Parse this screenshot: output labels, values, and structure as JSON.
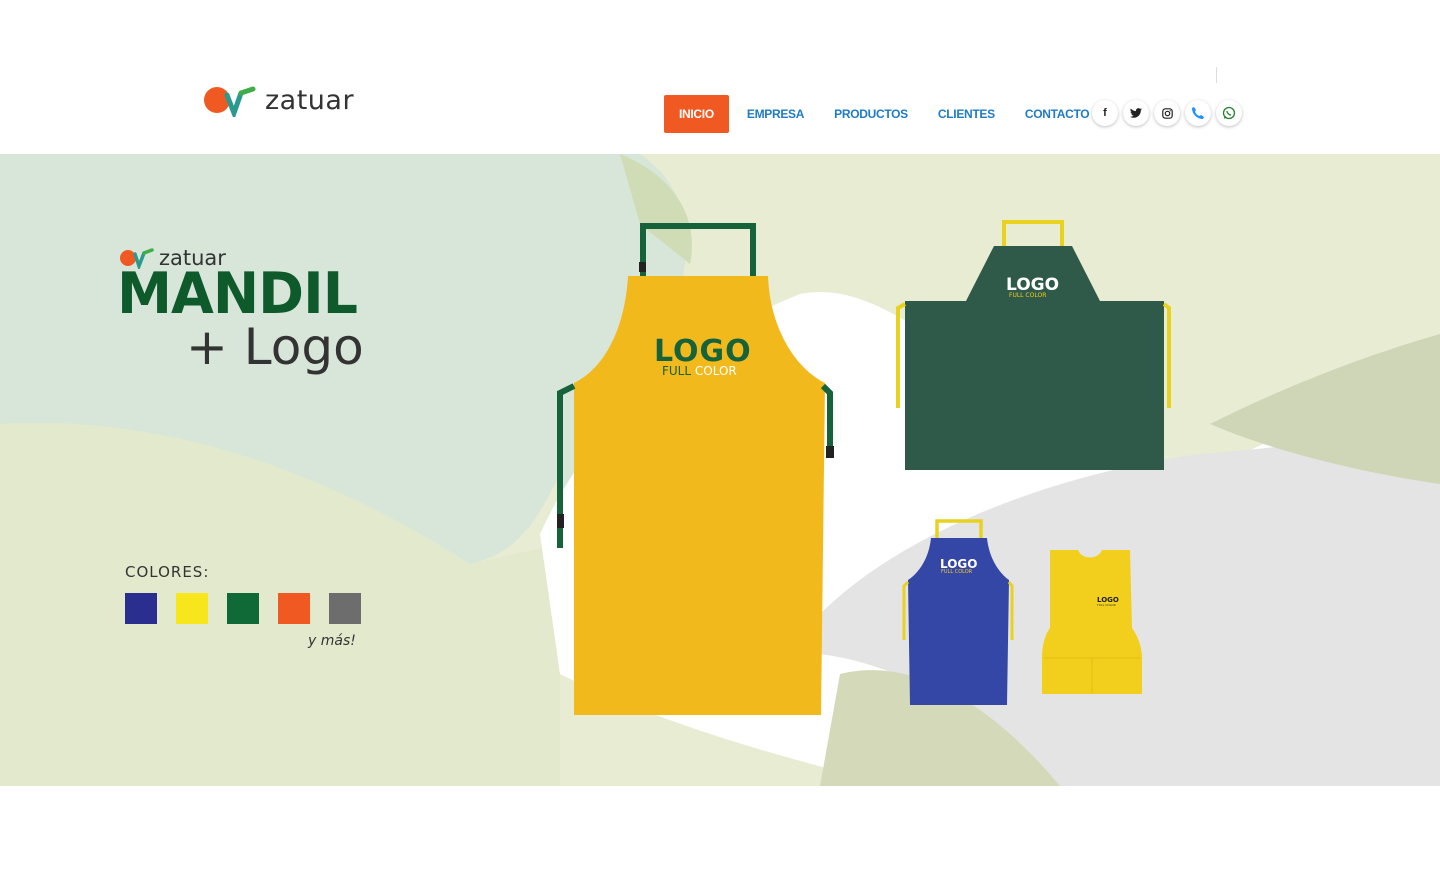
{
  "header": {
    "brand": "zatuar",
    "nav": [
      {
        "label": "INICIO",
        "active": true
      },
      {
        "label": "EMPRESA"
      },
      {
        "label": "PRODUCTOS"
      },
      {
        "label": "CLIENTES"
      },
      {
        "label": "CONTACTO"
      }
    ],
    "social": [
      {
        "icon": "facebook-icon",
        "glyph": "f"
      },
      {
        "icon": "twitter-icon",
        "glyph": "🐦"
      },
      {
        "icon": "instagram-icon",
        "glyph": "◎"
      },
      {
        "icon": "phone-icon",
        "glyph": "✆"
      },
      {
        "icon": "whatsapp-icon",
        "glyph": "✆"
      }
    ],
    "colors": {
      "accent": "#f05a22",
      "nav_link": "#1e7bc4"
    }
  },
  "banner": {
    "brand": "zatuar",
    "title": "MANDIL",
    "subtitle": "+ Logo",
    "colors_label": "COLORES:",
    "swatches": [
      "#2a2f8f",
      "#f7e61b",
      "#0f6a37",
      "#f05a22",
      "#6d6d6d"
    ],
    "more": "y más!",
    "aprons": [
      {
        "name": "yellow-apron",
        "color": "#f2b91c",
        "logo": "LOGO",
        "logo_sub_1": "FULL",
        "logo_sub_2": "COLOR"
      },
      {
        "name": "green-apron",
        "color": "#2f5a4a",
        "logo": "LOGO",
        "logo_sub": "FULL COLOR"
      },
      {
        "name": "blue-apron",
        "color": "#3447a6",
        "logo": "LOGO",
        "logo_sub": "FULL COLOR"
      },
      {
        "name": "yellow-bib",
        "color": "#f2cf1c",
        "logo": "LOGO",
        "logo_sub": "FULL COLOR"
      }
    ]
  }
}
